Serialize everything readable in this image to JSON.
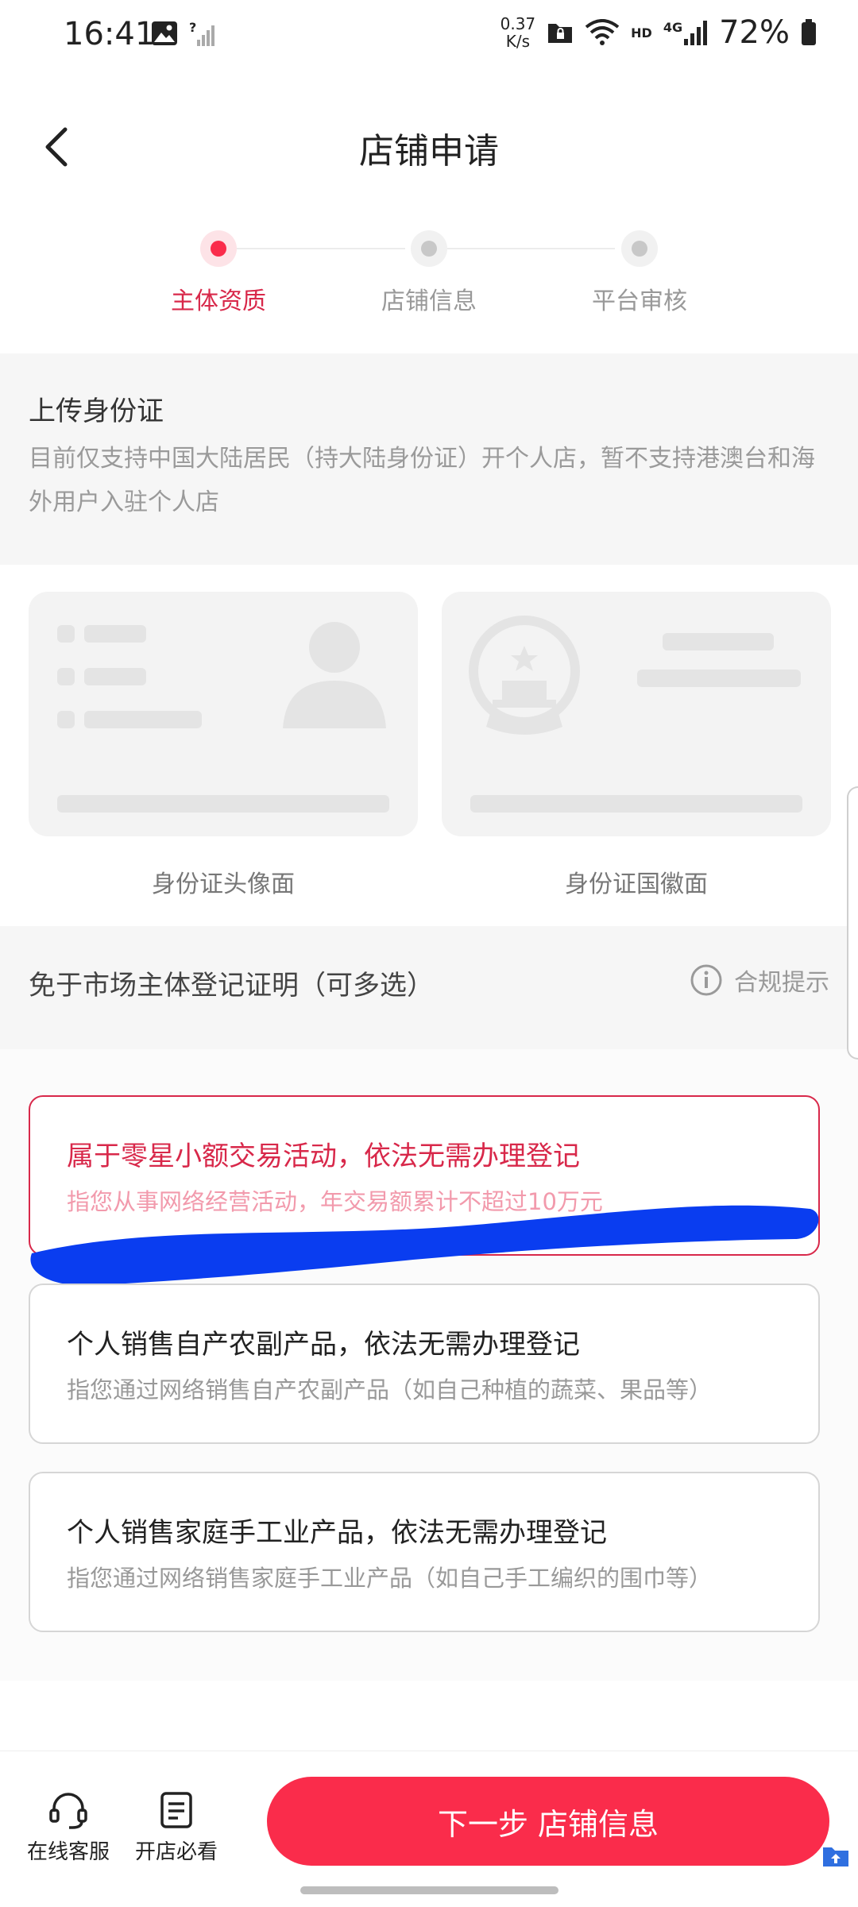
{
  "status_bar": {
    "time": "16:41",
    "netspeed_value": "0.37",
    "netspeed_unit": "K/s",
    "hd_label": "HD",
    "network_label": "4G",
    "battery": "72%"
  },
  "header": {
    "title": "店铺申请"
  },
  "steps": [
    {
      "label": "主体资质",
      "active": true
    },
    {
      "label": "店铺信息",
      "active": false
    },
    {
      "label": "平台审核",
      "active": false
    }
  ],
  "upload": {
    "title": "上传身份证",
    "description": "目前仅支持中国大陆居民（持大陆身份证）开个人店，暂不支持港澳台和海外用户入驻个人店",
    "front_label": "身份证头像面",
    "back_label": "身份证国徽面"
  },
  "exemption": {
    "title": "免于市场主体登记证明（可多选）",
    "compliance_label": "合规提示",
    "options": [
      {
        "title": "属于零星小额交易活动，依法无需办理登记",
        "desc": "指您从事网络经营活动，年交易额累计不超过10万元",
        "selected": true
      },
      {
        "title": "个人销售自产农副产品，依法无需办理登记",
        "desc": "指您通过网络销售自产农副产品（如自己种植的蔬菜、果品等）",
        "selected": false
      },
      {
        "title": "个人销售家庭手工业产品，依法无需办理登记",
        "desc": "指您通过网络销售家庭手工业产品（如自己手工编织的围巾等）",
        "selected": false
      }
    ]
  },
  "bottom": {
    "service_label": "在线客服",
    "guide_label": "开店必看",
    "next_label": "下一步 店铺信息"
  },
  "colors": {
    "accent": "#fa2c4b",
    "selected_title": "#d8284a",
    "selected_desc": "#f29aac",
    "scribble": "#0a3df0"
  }
}
